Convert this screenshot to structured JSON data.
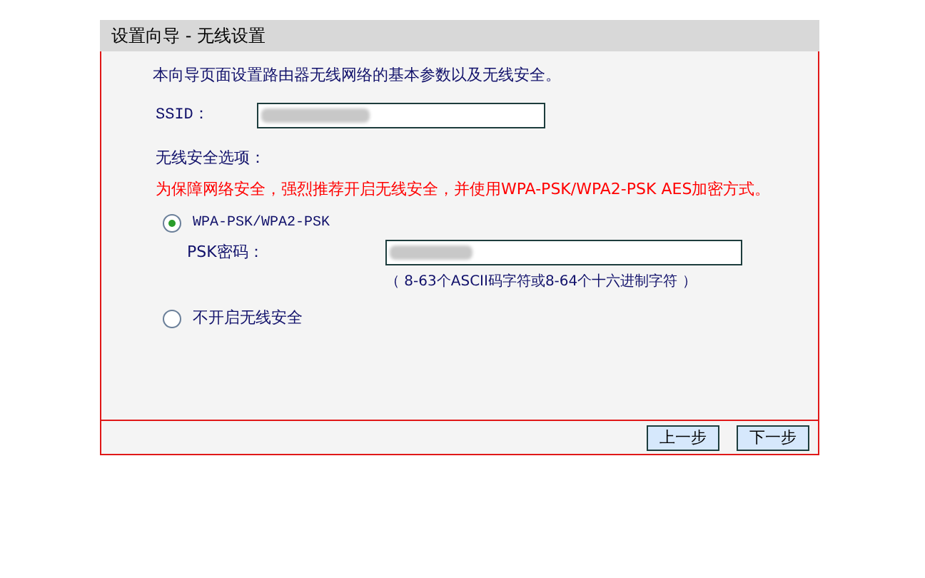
{
  "window": {
    "title": "设置向导 - 无线设置"
  },
  "intro": "本向导页面设置路由器无线网络的基本参数以及无线安全。",
  "ssid": {
    "label": "SSID："
  },
  "security": {
    "label": "无线安全选项：",
    "warning": "为保障网络安全，强烈推荐开启无线安全，并使用WPA-PSK/WPA2-PSK AES加密方式。",
    "options": [
      {
        "kind": "wpa",
        "label": "WPA-PSK/WPA2-PSK",
        "selected": true,
        "psk_label": "PSK密码：",
        "hint": "（ 8-63个ASCII码字符或8-64个十六进制字符 ）"
      },
      {
        "kind": "none",
        "label": "不开启无线安全",
        "selected": false
      }
    ]
  },
  "buttons": [
    "上一步",
    "下一步"
  ]
}
